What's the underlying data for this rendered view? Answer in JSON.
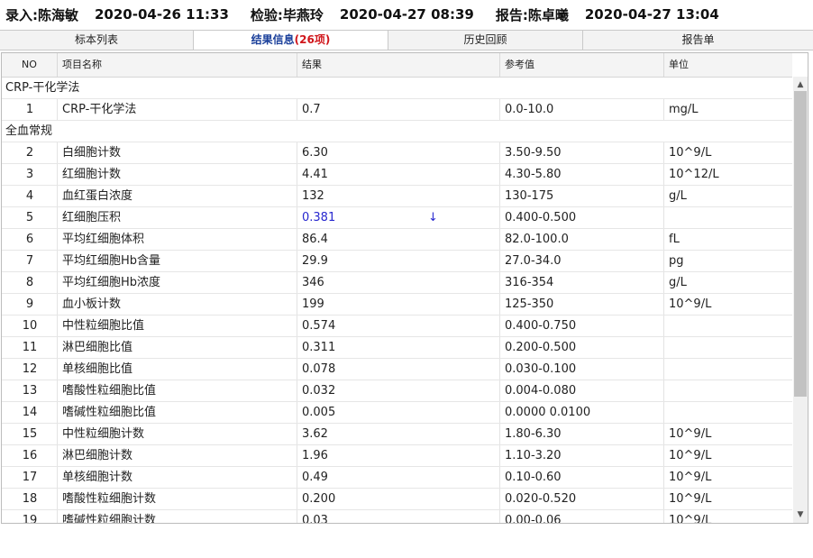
{
  "header": {
    "entry": "录入:陈海敏",
    "entry_time": "2020-04-26 11:33",
    "inspect": "检验:毕燕玲",
    "inspect_time": "2020-04-27 08:39",
    "report": "报告:陈卓曦",
    "report_time": "2020-04-27 13:04"
  },
  "tabs": [
    {
      "label": "标本列表"
    },
    {
      "label": "结果信息",
      "count": "(26项)"
    },
    {
      "label": "历史回顾"
    },
    {
      "label": "报告单"
    }
  ],
  "columns": {
    "no": "NO",
    "name": "项目名称",
    "result": "结果",
    "ref": "参考值",
    "unit": "单位"
  },
  "groups": {
    "g1": "CRP-干化学法",
    "g2": "全血常规"
  },
  "rows": [
    {
      "no": "1",
      "name": "CRP-干化学法",
      "result": "0.7",
      "flag": "",
      "ref": "0.0-10.0",
      "unit": "mg/L"
    },
    {
      "no": "2",
      "name": "白细胞计数",
      "result": "6.30",
      "flag": "",
      "ref": "3.50-9.50",
      "unit": "10^9/L"
    },
    {
      "no": "3",
      "name": "红细胞计数",
      "result": "4.41",
      "flag": "",
      "ref": "4.30-5.80",
      "unit": "10^12/L"
    },
    {
      "no": "4",
      "name": "血红蛋白浓度",
      "result": "132",
      "flag": "",
      "ref": "130-175",
      "unit": "g/L"
    },
    {
      "no": "5",
      "name": "红细胞压积",
      "result": "0.381",
      "flag": "↓",
      "ref": "0.400-0.500",
      "unit": ""
    },
    {
      "no": "6",
      "name": "平均红细胞体积",
      "result": "86.4",
      "flag": "",
      "ref": "82.0-100.0",
      "unit": "fL"
    },
    {
      "no": "7",
      "name": "平均红细胞Hb含量",
      "result": "29.9",
      "flag": "",
      "ref": "27.0-34.0",
      "unit": "pg"
    },
    {
      "no": "8",
      "name": "平均红细胞Hb浓度",
      "result": "346",
      "flag": "",
      "ref": "316-354",
      "unit": "g/L"
    },
    {
      "no": "9",
      "name": "血小板计数",
      "result": "199",
      "flag": "",
      "ref": "125-350",
      "unit": "10^9/L"
    },
    {
      "no": "10",
      "name": "中性粒细胞比值",
      "result": "0.574",
      "flag": "",
      "ref": "0.400-0.750",
      "unit": ""
    },
    {
      "no": "11",
      "name": "淋巴细胞比值",
      "result": "0.311",
      "flag": "",
      "ref": "0.200-0.500",
      "unit": ""
    },
    {
      "no": "12",
      "name": "单核细胞比值",
      "result": "0.078",
      "flag": "",
      "ref": "0.030-0.100",
      "unit": ""
    },
    {
      "no": "13",
      "name": "嗜酸性粒细胞比值",
      "result": "0.032",
      "flag": "",
      "ref": "0.004-0.080",
      "unit": ""
    },
    {
      "no": "14",
      "name": "嗜碱性粒细胞比值",
      "result": "0.005",
      "flag": "",
      "ref": "0.0000 0.0100",
      "unit": ""
    },
    {
      "no": "15",
      "name": "中性粒细胞计数",
      "result": "3.62",
      "flag": "",
      "ref": "1.80-6.30",
      "unit": "10^9/L"
    },
    {
      "no": "16",
      "name": "淋巴细胞计数",
      "result": "1.96",
      "flag": "",
      "ref": "1.10-3.20",
      "unit": "10^9/L"
    },
    {
      "no": "17",
      "name": "单核细胞计数",
      "result": "0.49",
      "flag": "",
      "ref": "0.10-0.60",
      "unit": "10^9/L"
    },
    {
      "no": "18",
      "name": "嗜酸性粒细胞计数",
      "result": "0.200",
      "flag": "",
      "ref": "0.020-0.520",
      "unit": "10^9/L"
    },
    {
      "no": "19",
      "name": "嗜碱性粒细胞计数",
      "result": "0.03",
      "flag": "",
      "ref": "0.00-0.06",
      "unit": "10^9/L"
    }
  ]
}
